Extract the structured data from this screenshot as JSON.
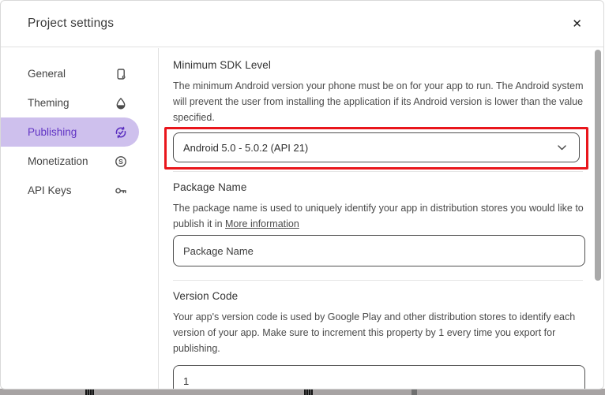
{
  "dialog": {
    "title": "Project settings",
    "close_label": "✕"
  },
  "sidebar": {
    "items": [
      {
        "label": "General",
        "icon": "device-icon",
        "selected": false
      },
      {
        "label": "Theming",
        "icon": "droplet-icon",
        "selected": false
      },
      {
        "label": "Publishing",
        "icon": "sync-check-icon",
        "selected": true
      },
      {
        "label": "Monetization",
        "icon": "dollar-circle-icon",
        "selected": false
      },
      {
        "label": "API Keys",
        "icon": "key-icon",
        "selected": false
      }
    ]
  },
  "content": {
    "sections": [
      {
        "heading": "Minimum SDK Level",
        "description": "The minimum Android version your phone must be on for your app to run. The Android system will prevent the user from installing the application if its Android version is lower than the value specified.",
        "value": "Android 5.0 - 5.0.2 (API 21)"
      },
      {
        "heading": "Package Name",
        "description": "The package name is used to uniquely identify your app in distribution stores you would like to publish it in ",
        "link_label": "More information",
        "placeholder": "Package Name",
        "value": ""
      },
      {
        "heading": "Version Code",
        "description": "Your app's version code is used by Google Play and other distribution stores to identify each version of your app. Make sure to increment this property by 1 every time you export for publishing.",
        "value": "1"
      }
    ]
  },
  "colors": {
    "accent_purple": "#6134c4",
    "selected_pill_bg": "#cec0ed",
    "annotation_red": "#e9161c",
    "scrollbar_thumb": "#a9a9a9"
  }
}
